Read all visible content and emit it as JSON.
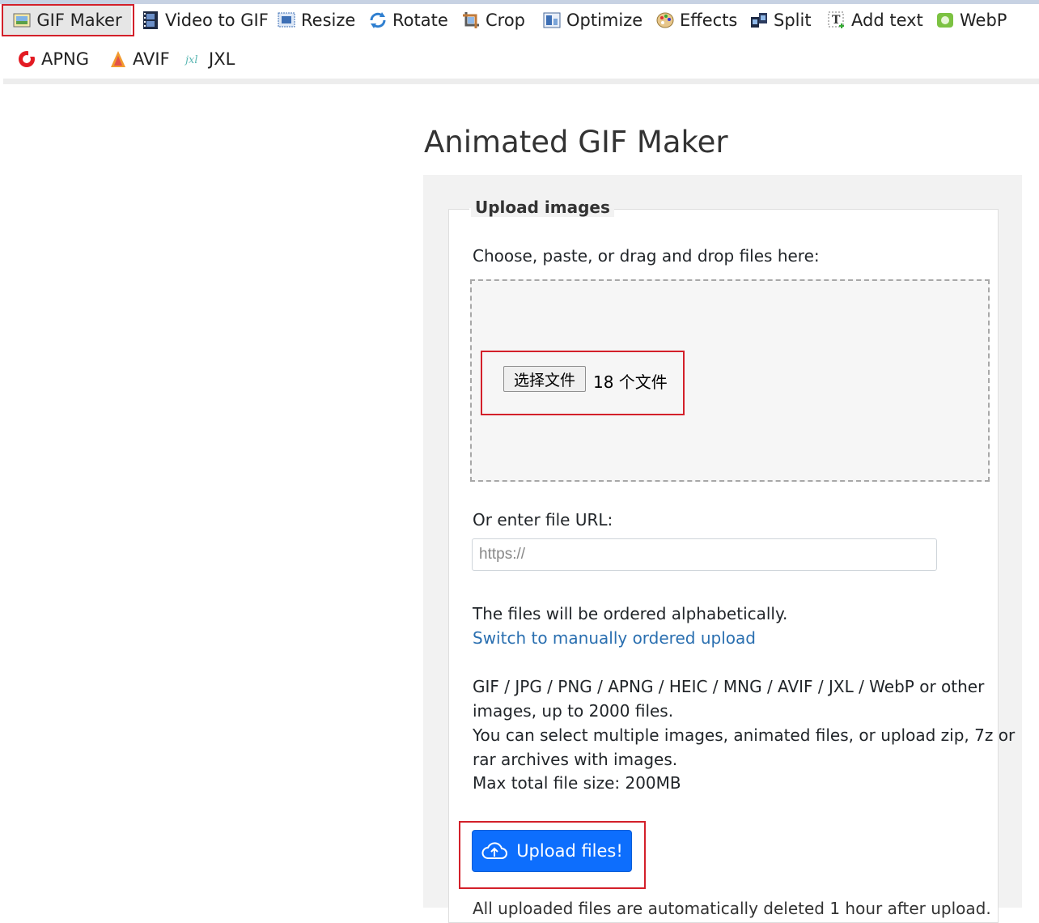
{
  "nav": {
    "items": [
      {
        "label": "GIF Maker",
        "icon": "gif-maker-icon"
      },
      {
        "label": "Video to GIF",
        "icon": "film-icon"
      },
      {
        "label": "Resize",
        "icon": "resize-icon"
      },
      {
        "label": "Rotate",
        "icon": "rotate-icon"
      },
      {
        "label": "Crop",
        "icon": "crop-icon"
      },
      {
        "label": "Optimize",
        "icon": "optimize-icon"
      },
      {
        "label": "Effects",
        "icon": "palette-icon"
      },
      {
        "label": "Split",
        "icon": "split-icon"
      },
      {
        "label": "Add text",
        "icon": "add-text-icon"
      },
      {
        "label": "WebP",
        "icon": "webp-icon"
      },
      {
        "label": "APNG",
        "icon": "apng-icon"
      },
      {
        "label": "AVIF",
        "icon": "avif-icon"
      },
      {
        "label": "JXL",
        "icon": "jxl-icon"
      }
    ]
  },
  "page": {
    "title": "Animated GIF Maker"
  },
  "upload": {
    "legend": "Upload images",
    "choose_label": "Choose, paste, or drag and drop files here:",
    "file_button": "选择文件",
    "file_count": "18 个文件",
    "url_label": "Or enter file URL:",
    "url_placeholder": "https://",
    "order_note": "The files will be ordered alphabetically.",
    "switch_link": "Switch to manually ordered upload",
    "formats_line1": "GIF / JPG / PNG / APNG / HEIC / MNG / AVIF / JXL / WebP or other",
    "formats_line2": "images, up to 2000 files.",
    "select_line1": "You can select multiple images, animated files, or upload zip, 7z or",
    "select_line2": "rar archives with images.",
    "max_size": "Max total file size: 200MB",
    "submit_button": "Upload files!",
    "cutoff_text": "All uploaded files are automatically deleted 1 hour after upload."
  },
  "colors": {
    "accent": "#0d6efd",
    "link": "#2a6fb0",
    "highlight": "#d3202a"
  }
}
